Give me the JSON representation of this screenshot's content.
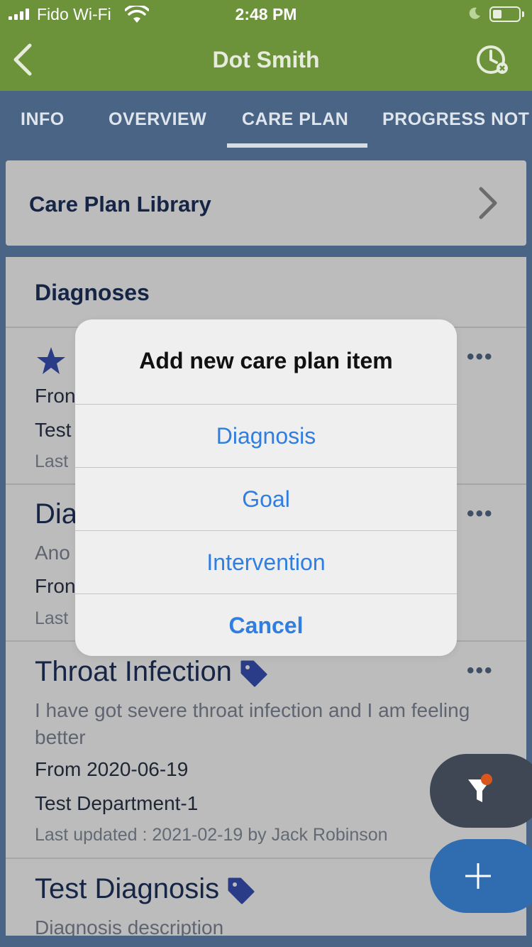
{
  "status_bar": {
    "carrier": "Fido Wi-Fi",
    "time": "2:48 PM"
  },
  "nav": {
    "title": "Dot Smith",
    "back_icon": "chevron-left-icon",
    "history_icon": "clock-history-icon"
  },
  "tabs": [
    {
      "label": "INFO"
    },
    {
      "label": "OVERVIEW"
    },
    {
      "label": "CARE PLAN",
      "active": true
    },
    {
      "label": "PROGRESS NOT"
    }
  ],
  "library": {
    "label": "Care Plan Library"
  },
  "diagnoses": {
    "section_title": "Diagnoses",
    "items": [
      {
        "line1": "Fron",
        "line2": "Test",
        "meta": "Last"
      },
      {
        "title": "Dia",
        "desc": "Ano",
        "line1": "Fron",
        "meta": "Last"
      },
      {
        "title": "Throat Infection",
        "desc": "I have got severe throat infection and I am feeling better",
        "line1": "From 2020-06-19",
        "line2": "Test Department-1",
        "meta": "Last updated : 2021-02-19 by Jack Robinson"
      },
      {
        "title": "Test Diagnosis",
        "desc": "Diagnosis description"
      }
    ],
    "more_label": "•••"
  },
  "modal": {
    "title": "Add new care plan item",
    "options": [
      "Diagnosis",
      "Goal",
      "Intervention"
    ],
    "cancel": "Cancel"
  },
  "colors": {
    "nav_green": "#6c923a",
    "page_blue": "#4a6485",
    "card_gray": "#bcbcbc",
    "link_blue": "#2f7ee0",
    "fab_blue": "#2f6cb0",
    "fab_dark": "#3e4753",
    "badge_orange": "#d9571f"
  }
}
